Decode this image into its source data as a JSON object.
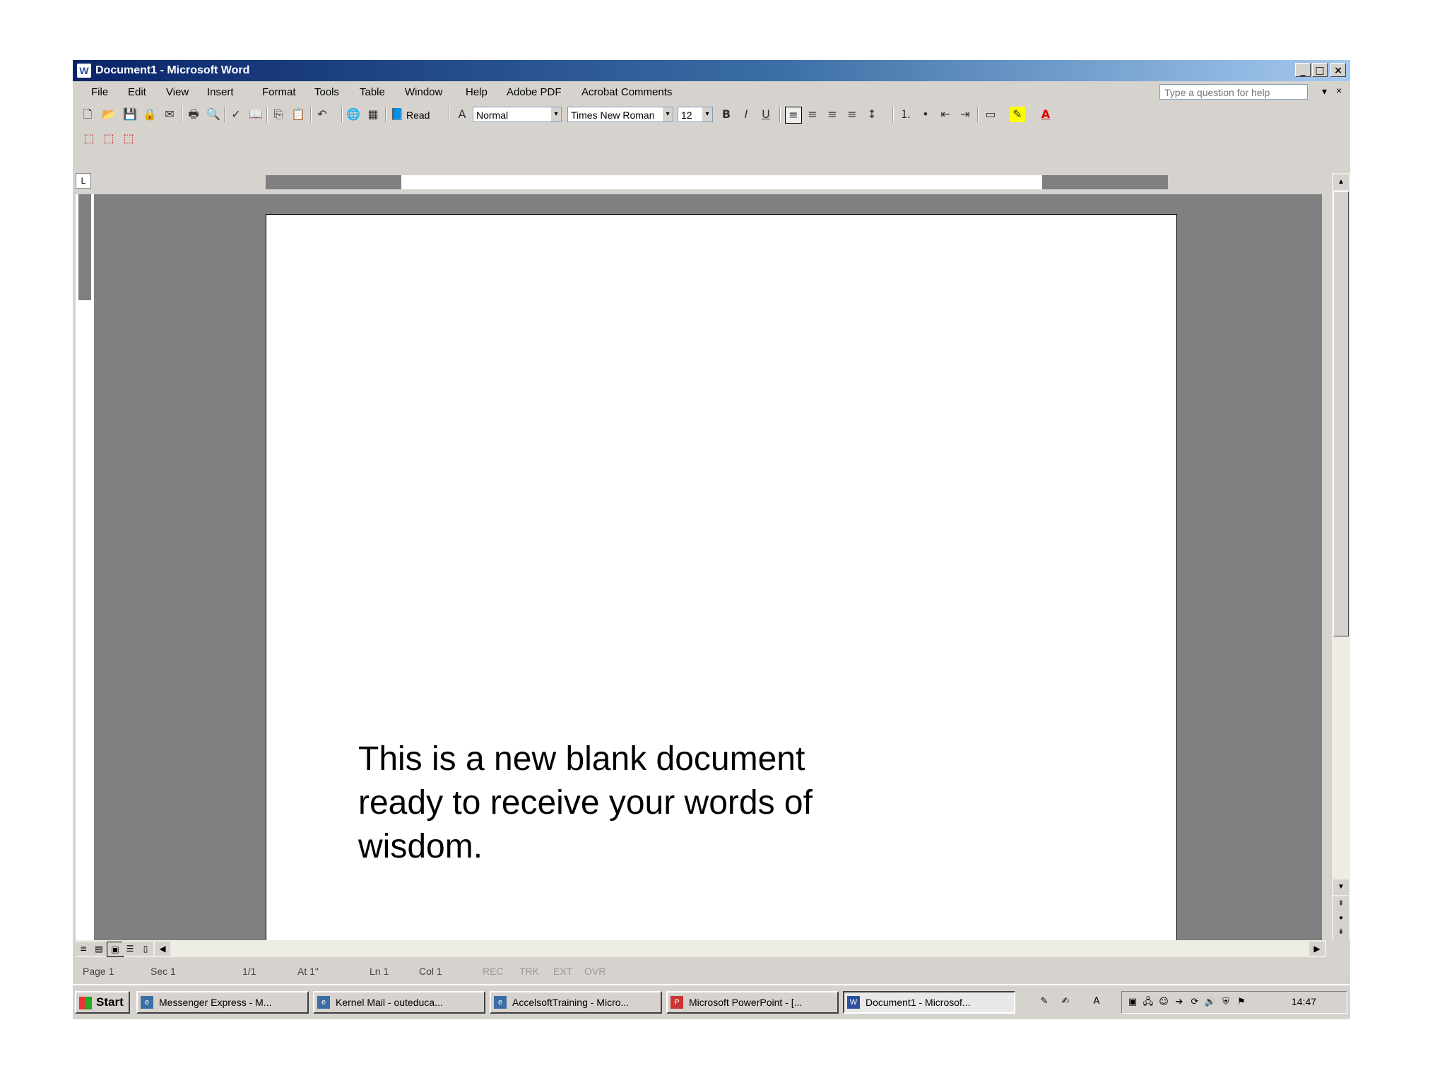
{
  "window": {
    "title": "Document1 - Microsoft Word",
    "app_icon": "W",
    "caption_buttons": {
      "minimize": "_",
      "maximize": "□",
      "close": "×"
    }
  },
  "menu": {
    "items": [
      "File",
      "Edit",
      "View",
      "Insert",
      "Format",
      "Tools",
      "Table",
      "Window",
      "Help",
      "Adobe PDF",
      "Acrobat Comments"
    ],
    "ask_placeholder": "Type a question for help"
  },
  "toolbar": {
    "read_label": "Read",
    "style_value": "Normal",
    "font_value": "Times New Roman",
    "size_value": "12",
    "bold": "B",
    "italic": "I",
    "underline": "U",
    "font_color": "A"
  },
  "document": {
    "text": "This is a new blank document ready to receive your words of wisdom."
  },
  "status": {
    "page": "Page 1",
    "sec": "Sec 1",
    "pages": "1/1",
    "at": "At 1\"",
    "ln": "Ln 1",
    "col": "Col 1",
    "rec": "REC",
    "trk": "TRK",
    "ext": "EXT",
    "ovr": "OVR"
  },
  "taskbar": {
    "start": "Start",
    "tasks": [
      "Messenger Express - M...",
      "Kernel Mail - outeduca...",
      "AccelsoftTraining - Micro...",
      "Microsoft PowerPoint - [...",
      "Document1 - Microsof..."
    ],
    "clock": "14:47"
  },
  "colors": {
    "title_gradient_start": "#0a246a",
    "title_gradient_end": "#a6caf0",
    "chrome": "#d6d3ce",
    "canvas": "#808080"
  }
}
